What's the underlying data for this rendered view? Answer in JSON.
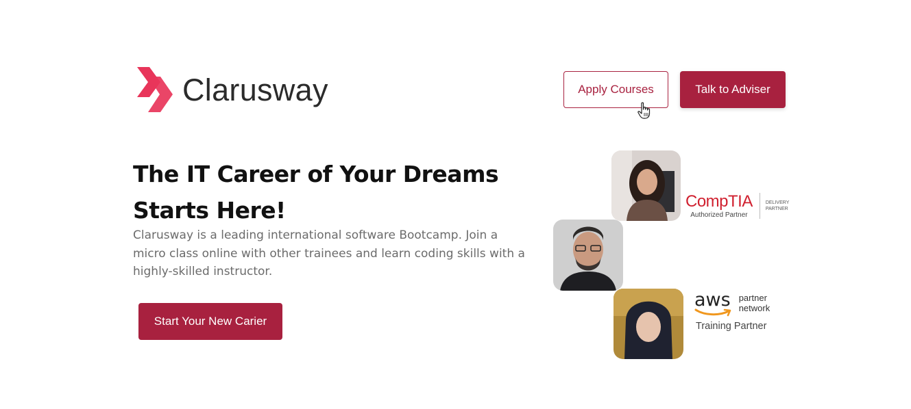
{
  "brand": {
    "name": "Clarusway",
    "accent_color": "#a8213f",
    "logo_color": "#e8355a"
  },
  "header": {
    "apply_label": "Apply Courses",
    "adviser_label": "Talk to Adviser"
  },
  "hero": {
    "headline": "The IT Career of Your Dreams Starts Here!",
    "description": "Clarusway is a leading international software Bootcamp. Join a micro class online with other trainees and learn coding skills with a highly-skilled instructor.",
    "cta_label": "Start Your New Carier"
  },
  "partners": {
    "comptia": {
      "logo": "CompTIA",
      "subtitle": "Authorized Partner",
      "side_line1": "DELIVERY",
      "side_line2": "PARTNER"
    },
    "aws": {
      "logo": "aws",
      "line1": "partner",
      "line2": "network",
      "subtitle": "Training Partner"
    }
  },
  "icons": {
    "logo": "clarusway-chevrons-icon",
    "cursor": "hand-pointer-icon"
  }
}
